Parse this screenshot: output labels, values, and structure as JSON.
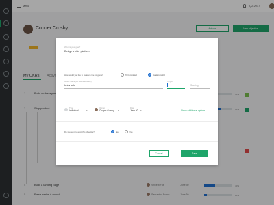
{
  "topbar": {
    "menu_label": "Menu",
    "q_label": "Q2 2017"
  },
  "profile": {
    "name": "Cooper Crosby"
  },
  "header_buttons": {
    "secondary": "Actions",
    "primary": "New objective"
  },
  "tabs": [
    "My OKRs",
    "Activity"
  ],
  "background_rows": [
    {
      "num": "1",
      "text": "Build on Instagram",
      "date": "",
      "pct": "40%"
    },
    {
      "num": "2",
      "text": "Ship product",
      "date": "",
      "pct": "60%"
    },
    {
      "num": "4",
      "text": "Build a landing page",
      "date": "June 30",
      "pct": "40%"
    },
    {
      "num": "5",
      "text": "Raise series A round",
      "date": "June 30",
      "pct": "10%"
    }
  ],
  "background_people": [
    "Vincent Fox",
    "Samantha Evans"
  ],
  "modal": {
    "goal_hint": "What is your goal?",
    "goal_value": "Design a killer platform",
    "measure_question": "How would you like to measure the progress?",
    "measure_opt_completed": "% Completed",
    "measure_opt_metric": "Custom metric",
    "metric_hint": "Metric name (ex: website users)",
    "metric_value": "Units sold",
    "target_hint": "Target",
    "target_value": "",
    "starting_placeholder": "Starting",
    "type_hint": "Type",
    "type_value": "Individual",
    "owner_hint": "Owner",
    "owner_value": "Cooper Crosby",
    "date_hint": "Date",
    "date_value": "June 30",
    "more_options": "Show additional options",
    "align_question": "Do you want to align this objective?",
    "align_no": "No",
    "align_yes": "Yes",
    "cancel": "Cancel",
    "save": "Save"
  },
  "colors": {
    "accent": "#1fa56a",
    "progress": "#1f6fd0",
    "sidebar": "#2d3134"
  }
}
